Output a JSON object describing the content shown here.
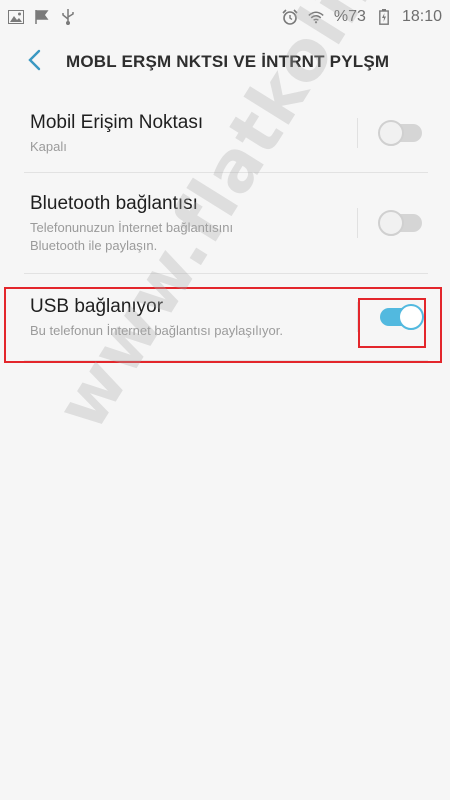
{
  "status_bar": {
    "battery": "%73",
    "time": "18:10",
    "icons_left": [
      "image-icon",
      "check-flag-icon",
      "usb-icon"
    ],
    "icons_right": [
      "alarm-icon",
      "wifi-icon",
      "battery-icon"
    ]
  },
  "app_bar": {
    "title": "MOBL ERŞM NKTSI VE İNTRNT PYLŞM"
  },
  "items": [
    {
      "title": "Mobil Erişim Noktası",
      "subtitle": "Kapalı",
      "enabled": false
    },
    {
      "title": "Bluetooth bağlantısı",
      "subtitle_line1": "Telefonunuzun İnternet bağlantısını",
      "subtitle_line2": "Bluetooth ile paylaşın.",
      "enabled": false
    },
    {
      "title": "USB bağlanıyor",
      "subtitle": "Bu telefonun İnternet bağlantısı paylaşılıyor.",
      "enabled": true
    }
  ],
  "watermark": "www.flatkolik.net",
  "colors": {
    "accent": "#52b9df",
    "highlight": "#e3262b",
    "background": "#f6f6f6"
  }
}
